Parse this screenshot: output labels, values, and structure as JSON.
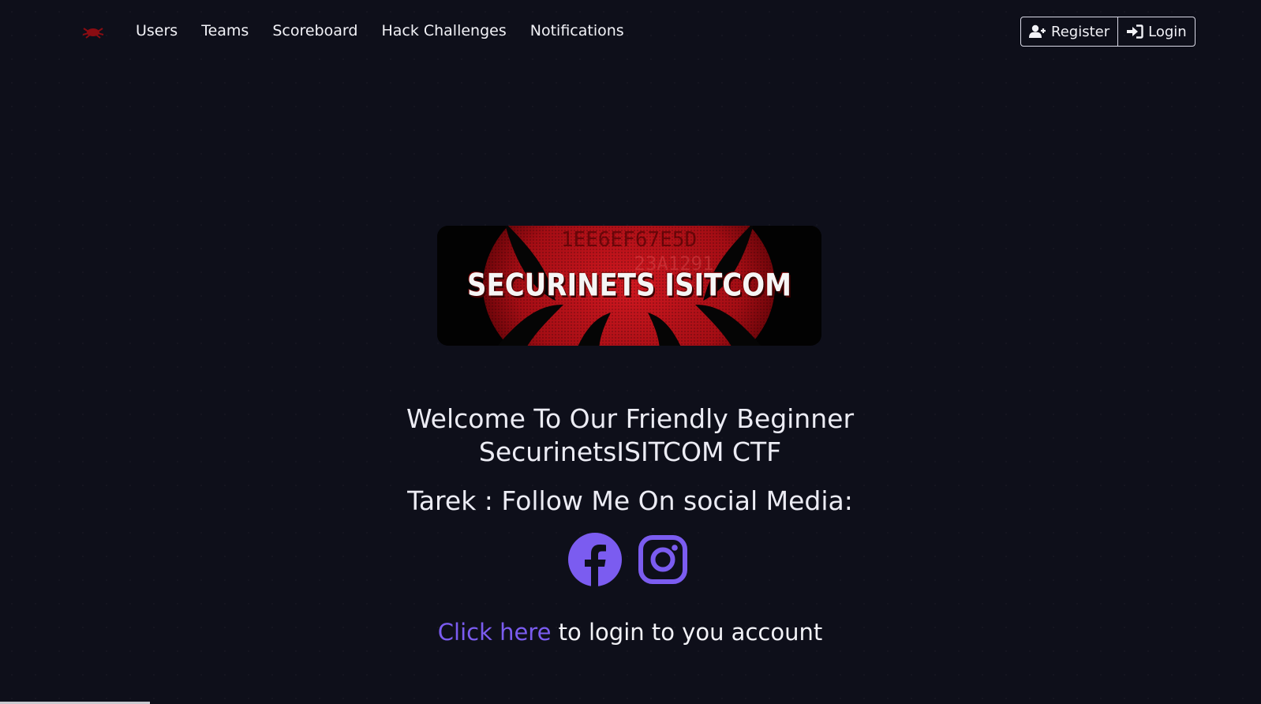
{
  "nav": {
    "logo_icon": "spider-icon",
    "links": [
      {
        "label": "Users"
      },
      {
        "label": "Teams"
      },
      {
        "label": "Scoreboard"
      },
      {
        "label": "Hack Challenges"
      },
      {
        "label": "Notifications"
      }
    ],
    "register_label": "Register",
    "login_label": "Login"
  },
  "banner": {
    "text": "SECURINETS ISITCOM",
    "hex_line_1": "1EE6EF67E5D",
    "hex_line_2": "23A1291"
  },
  "main": {
    "welcome_line_1": "Welcome To Our Friendly Beginner",
    "welcome_line_2": "SecurinetsISITCOM CTF",
    "follow_text": "Tarek : Follow Me On social Media:",
    "social_icons": [
      "facebook-icon",
      "instagram-icon"
    ],
    "login_link_text": "Click here",
    "login_rest_text": " to login to you account"
  },
  "colors": {
    "background": "#0e0f1a",
    "accent": "#7b5cf0",
    "banner_red": "#b3121b",
    "text": "#ececf4"
  }
}
